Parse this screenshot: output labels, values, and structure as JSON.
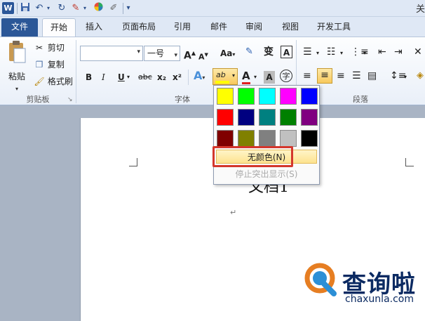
{
  "qat": {
    "logo": "W",
    "close": "关"
  },
  "tabs": [
    {
      "label": "文件"
    },
    {
      "label": "开始"
    },
    {
      "label": "插入"
    },
    {
      "label": "页面布局"
    },
    {
      "label": "引用"
    },
    {
      "label": "邮件"
    },
    {
      "label": "审阅"
    },
    {
      "label": "视图"
    },
    {
      "label": "开发工具"
    }
  ],
  "clipboard": {
    "paste": "粘贴",
    "cut": "剪切",
    "copy": "复制",
    "format_painter": "格式刷",
    "group": "剪贴板"
  },
  "font": {
    "font_name": "",
    "font_size": "一号",
    "group": "字体",
    "grow": "A",
    "shrink": "A",
    "case": "Aa",
    "phonetic": "变",
    "border": "A",
    "bold": "B",
    "italic": "I",
    "underline": "U",
    "strike": "abc",
    "subscript": "x₂",
    "superscript": "x²",
    "text_effect": "A",
    "highlight": "ab",
    "font_color": "A",
    "shade": "A",
    "enclose": "字"
  },
  "paragraph": {
    "group": "段落"
  },
  "highlight_menu": {
    "colors": [
      "#ffff00",
      "#00ff00",
      "#00ffff",
      "#ff00ff",
      "#0000ff",
      "#ff0000",
      "#000080",
      "#008080",
      "#008000",
      "#800080",
      "#800000",
      "#808000",
      "#808080",
      "#c0c0c0",
      "#000000"
    ],
    "no_color": "无颜色(N)",
    "stop": "停止突出显示(S)"
  },
  "document": {
    "title": "文档1",
    "para_mark": "↵"
  },
  "watermark": {
    "name": "查询啦",
    "url": "chaxunla.com"
  }
}
